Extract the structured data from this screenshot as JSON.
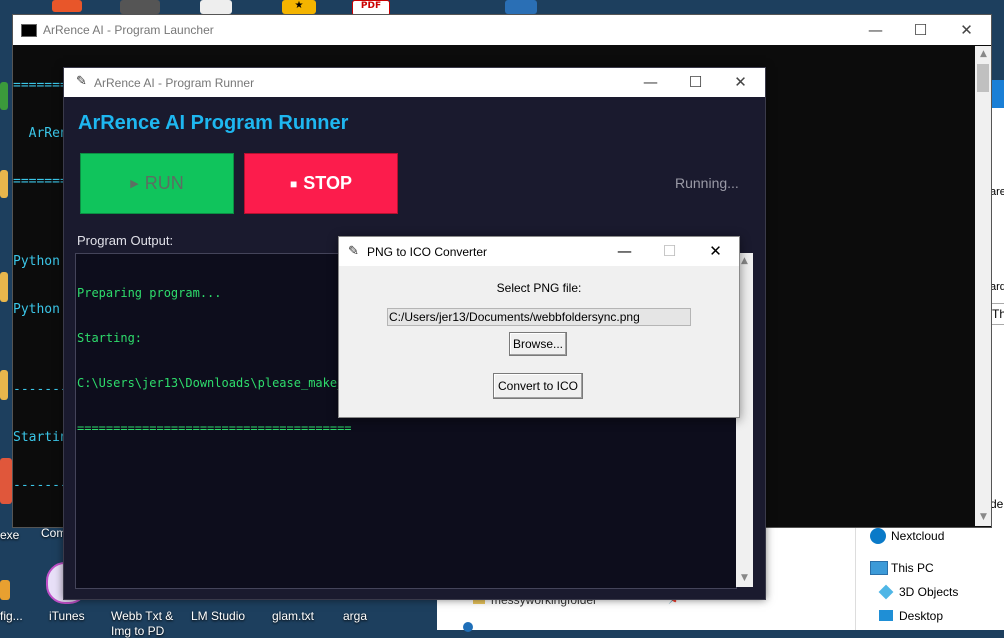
{
  "desktop": {
    "labels": {
      "itunes": "iTunes",
      "webb": "Webb Txt &",
      "webb2": "Img to PD",
      "lmstudio": "LM Studio",
      "glam": "glam.txt",
      "arga": "arga",
      "config": "fig...",
      "exe": "exe",
      "com": "Com",
      "pdf": "PDF"
    }
  },
  "explorer": {
    "nav": {
      "nextcloud": "Nextcloud",
      "thispc": "This PC",
      "objects3d": "3D Objects",
      "desktop": "Desktop"
    },
    "folder_row": "messyworkingfolder",
    "partial_right": [
      "are",
      "ard",
      "Th",
      "de"
    ]
  },
  "console": {
    "title": "ArRence AI - Program Launcher",
    "lines": [
      "========================================",
      "  ArRence AI Python Program Runner",
      "========================================",
      "",
      "Python",
      "Python",
      "",
      "----------",
      "Starting",
      "----------"
    ]
  },
  "runner": {
    "title": "ArRence AI - Program Runner",
    "heading": "ArRence AI Program Runner",
    "run_label": "RUN",
    "run_icon": "▶",
    "stop_label": "STOP",
    "stop_icon": "■",
    "status": "Running...",
    "output_label": "Program Output:",
    "output_lines": [
      "Preparing program...",
      "Starting:",
      "C:\\Users\\jer13\\Downloads\\please_make_a",
      "======================================"
    ],
    "colors": {
      "run": "#10c45c",
      "stop": "#fc1c4c",
      "heading": "#1eb7f0",
      "bg": "#1a1a2e",
      "output_text": "#2edc6c"
    }
  },
  "dialog": {
    "title": "PNG to ICO Converter",
    "select_label": "Select PNG file:",
    "path_value": "C:/Users/jer13/Documents/webbfoldersync.png",
    "browse_label": "Browse...",
    "convert_label": "Convert to ICO"
  },
  "window_controls": {
    "minimize": "—",
    "maximize": "☐",
    "close": "✕"
  }
}
